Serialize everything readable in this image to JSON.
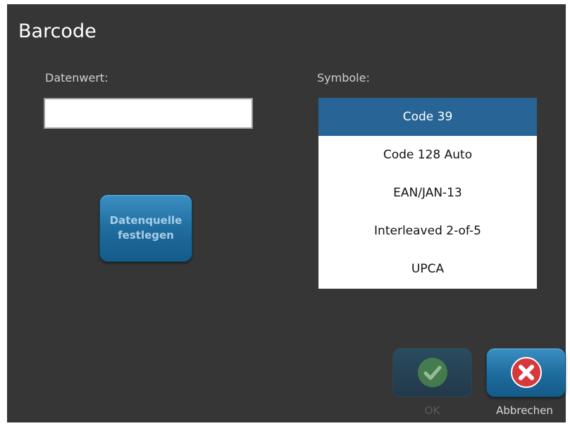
{
  "dialog": {
    "title": "Barcode"
  },
  "data_value": {
    "label": "Datenwert:",
    "value": ""
  },
  "data_source_button": {
    "line1": "Datenquelle",
    "line2": "festlegen"
  },
  "symbology": {
    "label": "Symbole:",
    "options": [
      "Code 39",
      "Code 128 Auto",
      "EAN/JAN-13",
      "Interleaved 2-of-5",
      "UPCA"
    ],
    "selected": "Code 39"
  },
  "actions": {
    "ok_label": "OK",
    "cancel_label": "Abbrechen"
  },
  "colors": {
    "background": "#363636",
    "selection": "#286495",
    "button_blue": "#1f6c9e",
    "ok_green": "#5fa85b",
    "cancel_red": "#d6383b"
  },
  "icons": {
    "ok": "check-circle-icon",
    "cancel": "x-circle-icon"
  }
}
